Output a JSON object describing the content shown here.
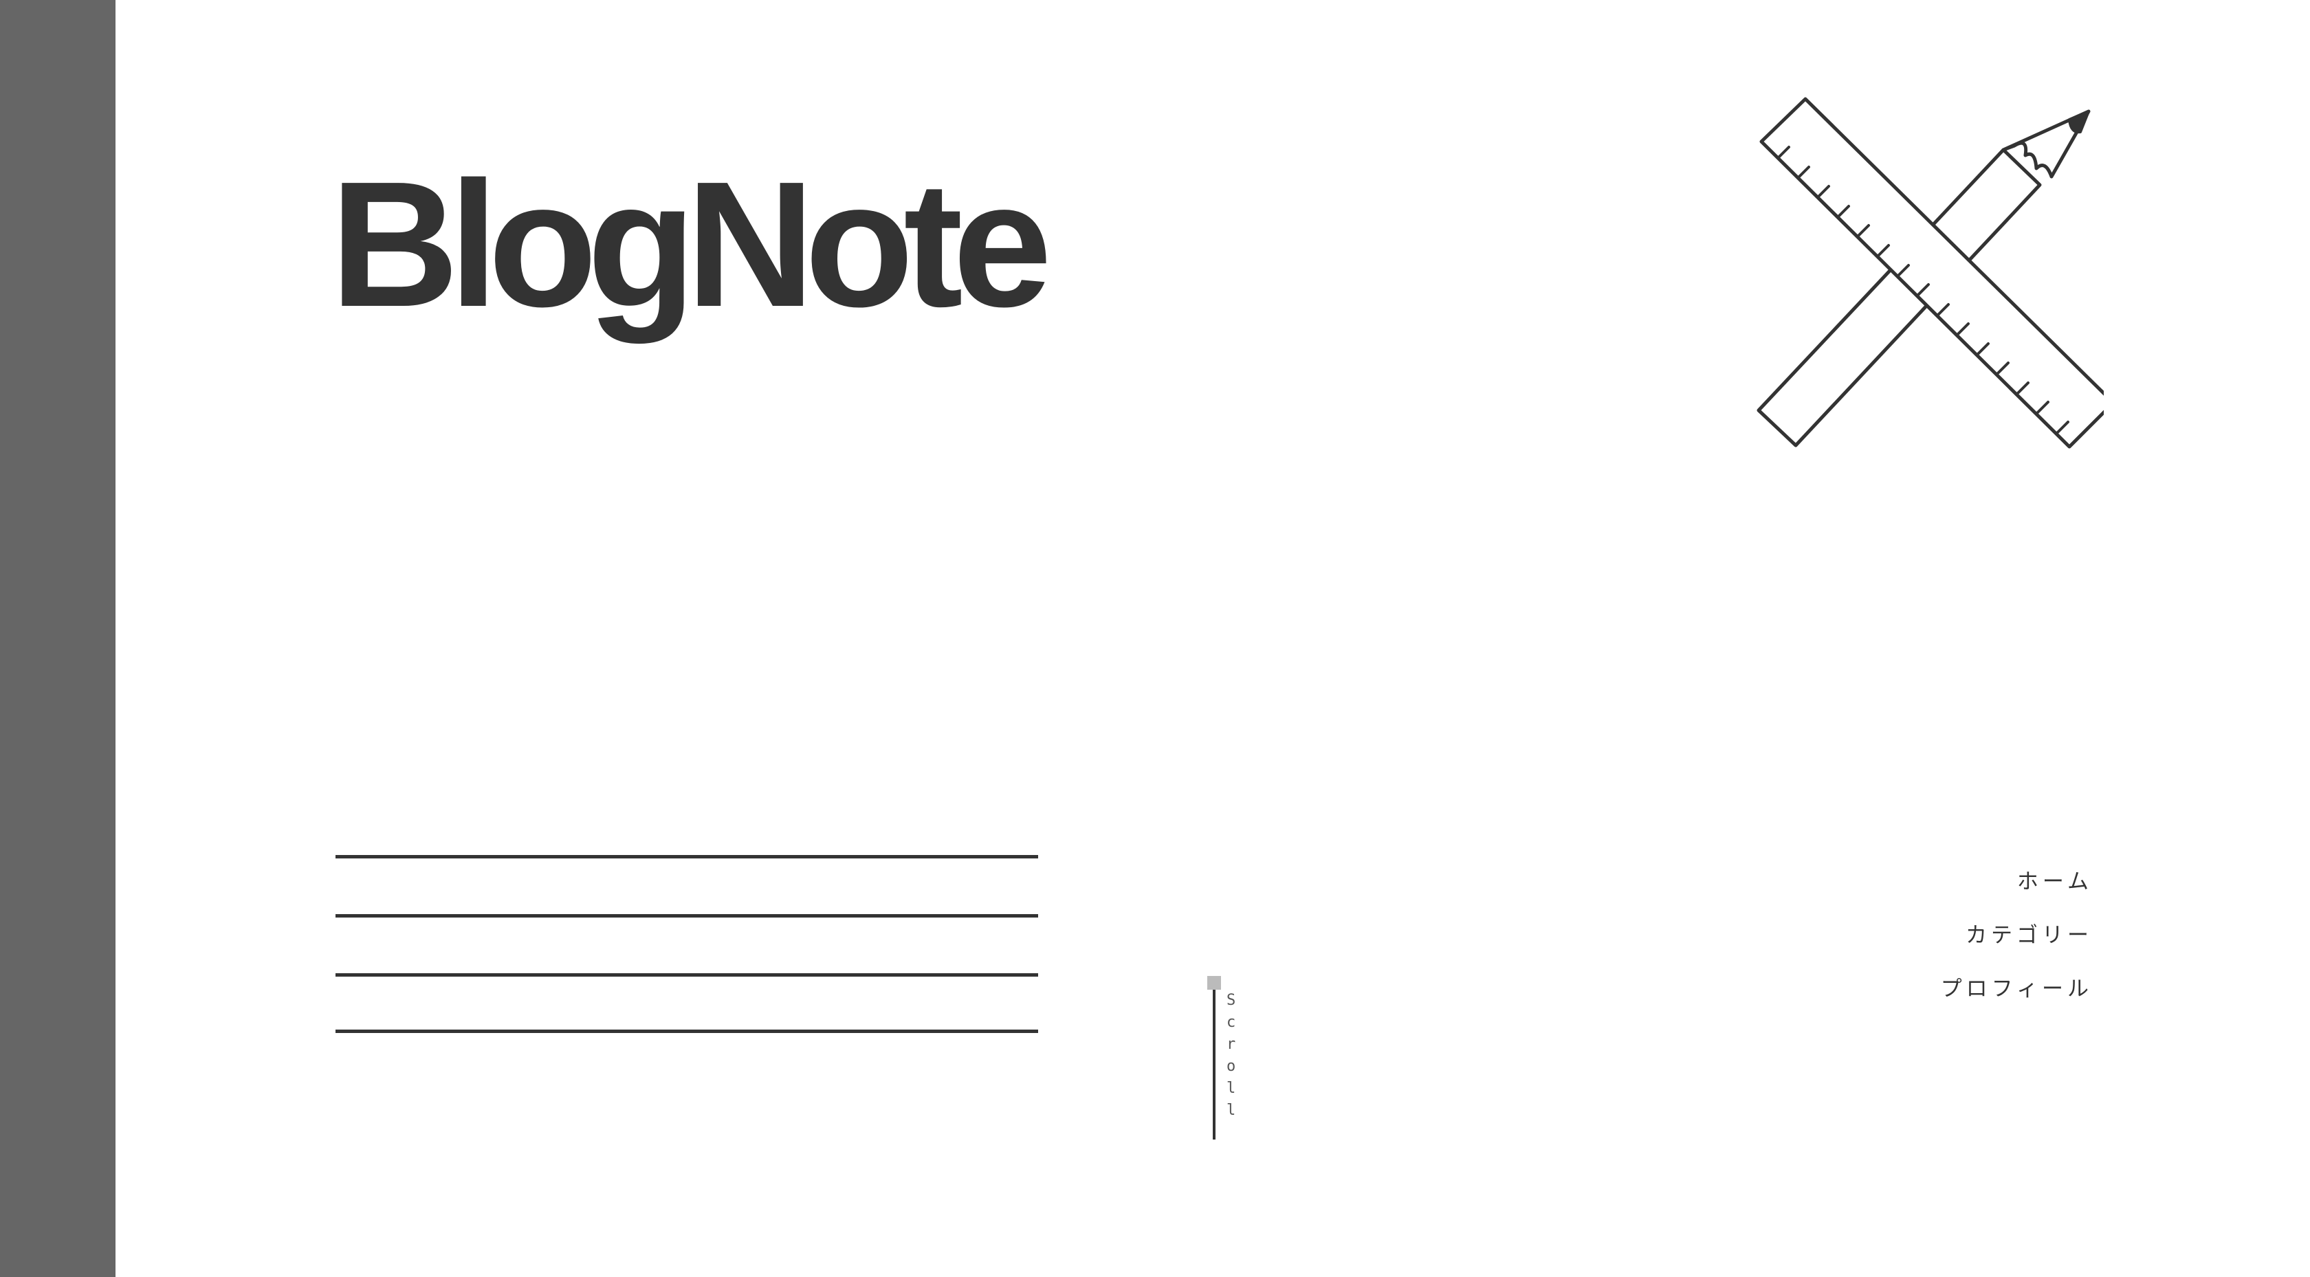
{
  "header": {
    "logo_text": "BlogNote"
  },
  "decoration": {
    "icon": "ruler-pencil-cross-icon"
  },
  "nav": {
    "items": [
      {
        "label": "ホーム"
      },
      {
        "label": "カテゴリー"
      },
      {
        "label": "プロフィール"
      }
    ]
  },
  "scroll": {
    "label": "Scroll"
  },
  "colors": {
    "sidebar": "#666666",
    "text": "#333333",
    "background": "#ffffff",
    "scroll_knob": "#bbbbbb"
  }
}
